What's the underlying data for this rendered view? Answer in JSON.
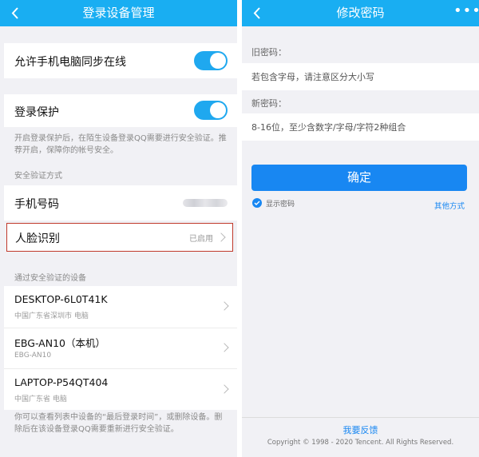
{
  "left": {
    "title": "登录设备管理",
    "sync_label": "允许手机电脑同步在线",
    "sync_on": true,
    "protect_label": "登录保护",
    "protect_on": true,
    "protect_note": "开启登录保护后，在陌生设备登录QQ需要进行安全验证。推荐开启，保障你的帐号安全。",
    "verify_section": "安全验证方式",
    "phone_label": "手机号码",
    "face_label": "人脸识别",
    "face_status": "已启用",
    "devices_section": "通过安全验证的设备",
    "devices": [
      {
        "name": "DESKTOP-6L0T41K",
        "sub": "中国广东省深圳市 电脑"
      },
      {
        "name": "EBG-AN10（本机）",
        "sub": "EBG-AN10"
      },
      {
        "name": "LAPTOP-P54QT404",
        "sub": "中国广东省 电脑"
      }
    ],
    "footer_note": "你可以查看列表中设备的“最后登录时间”，或删除设备。删除后在该设备登录QQ需要重新进行安全验证。",
    "accent": "#19aef2",
    "highlight_border": "#c0392b"
  },
  "right": {
    "title": "修改密码",
    "more": "•••",
    "old_label": "旧密码：",
    "old_placeholder": "若包含字母，请注意区分大小写",
    "new_label": "新密码：",
    "new_placeholder": "8-16位，至少含数字/字母/字符2种组合",
    "confirm": "确定",
    "show_password": "显示密码",
    "show_checked": true,
    "other_methods": "其他方式",
    "feedback": "我要反馈",
    "copyright": "Copyright © 1998 - 2020 Tencent. All Rights Reserved.",
    "button_color": "#1887f2"
  }
}
